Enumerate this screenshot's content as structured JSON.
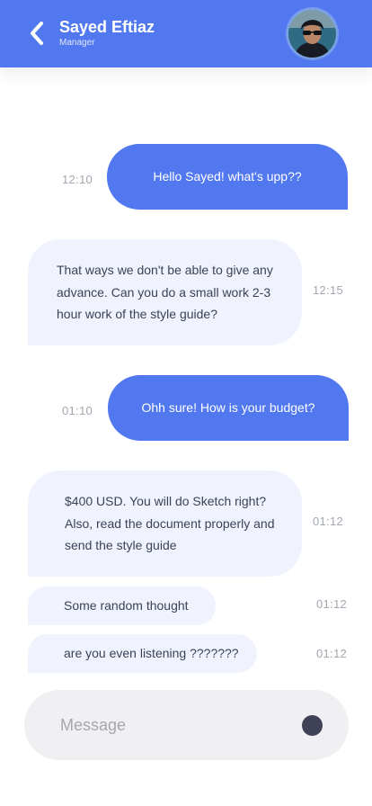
{
  "header": {
    "contact_name": "Sayed Eftiaz",
    "contact_role": "Manager",
    "background_color": "#5278f0",
    "back_icon": "chevron-left-icon",
    "avatar": "user-avatar-photo"
  },
  "messages": [
    {
      "direction": "outgoing",
      "text": "Hello Sayed! what's upp??",
      "time": "12:10"
    },
    {
      "direction": "incoming",
      "text": "That ways we don't be able to give any advance. Can you do a small work 2-3 hour work of the style guide?",
      "time": "12:15"
    },
    {
      "direction": "outgoing",
      "text": "Ohh sure! How is your budget?",
      "time": "01:10"
    },
    {
      "direction": "incoming",
      "text": "$400 USD. You will do Sketch right? Also, read the document properly and send the style guide",
      "time": "01:12"
    },
    {
      "direction": "incoming",
      "text": "Some random thought",
      "time": "01:12"
    },
    {
      "direction": "incoming",
      "text": "are you even listening ???????",
      "time": "01:12"
    }
  ],
  "composer": {
    "placeholder": "Message",
    "value": "",
    "send_icon": "send-dot-icon"
  },
  "colors": {
    "accent": "#5278f0",
    "incoming_bubble": "#f0f3fd",
    "composer_background": "#f0f0f2",
    "send_button": "#3f4256",
    "timestamp": "#a3a7b1"
  }
}
